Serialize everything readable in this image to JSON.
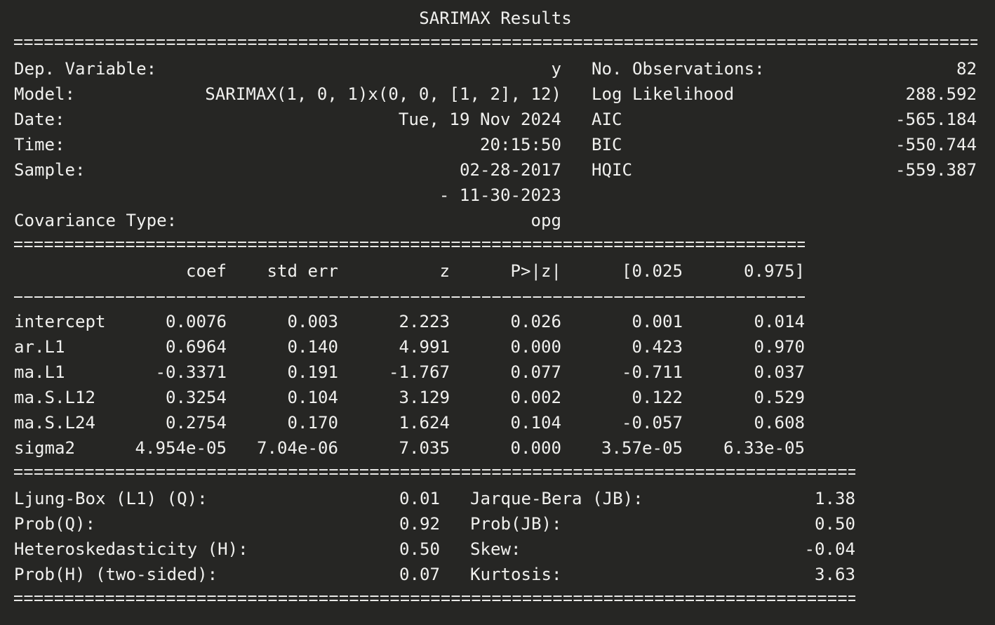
{
  "title": "SARIMAX Results",
  "summary": {
    "left": [
      {
        "label": "Dep. Variable:",
        "value": "y"
      },
      {
        "label": "Model:",
        "value": "SARIMAX(1, 0, 1)x(0, 0, [1, 2], 12)"
      },
      {
        "label": "Date:",
        "value": "Tue, 19 Nov 2024"
      },
      {
        "label": "Time:",
        "value": "20:15:50"
      },
      {
        "label": "Sample:",
        "value": "02-28-2017"
      },
      {
        "label": "",
        "value": "- 11-30-2023"
      },
      {
        "label": "Covariance Type:",
        "value": "opg"
      }
    ],
    "right": [
      {
        "label": "No. Observations:",
        "value": "82"
      },
      {
        "label": "Log Likelihood",
        "value": "288.592"
      },
      {
        "label": "AIC",
        "value": "-565.184"
      },
      {
        "label": "BIC",
        "value": "-550.744"
      },
      {
        "label": "HQIC",
        "value": "-559.387"
      }
    ]
  },
  "coef_table": {
    "headers": [
      "",
      "coef",
      "std err",
      "z",
      "P>|z|",
      "[0.025",
      "0.975]"
    ],
    "rows": [
      [
        "intercept",
        "0.0076",
        "0.003",
        "2.223",
        "0.026",
        "0.001",
        "0.014"
      ],
      [
        "ar.L1",
        "0.6964",
        "0.140",
        "4.991",
        "0.000",
        "0.423",
        "0.970"
      ],
      [
        "ma.L1",
        "-0.3371",
        "0.191",
        "-1.767",
        "0.077",
        "-0.711",
        "0.037"
      ],
      [
        "ma.S.L12",
        "0.3254",
        "0.104",
        "3.129",
        "0.002",
        "0.122",
        "0.529"
      ],
      [
        "ma.S.L24",
        "0.2754",
        "0.170",
        "1.624",
        "0.104",
        "-0.057",
        "0.608"
      ],
      [
        "sigma2",
        "4.954e-05",
        "7.04e-06",
        "7.035",
        "0.000",
        "3.57e-05",
        "6.33e-05"
      ]
    ]
  },
  "diagnostics": {
    "left": [
      {
        "label": "Ljung-Box (L1) (Q):",
        "value": "0.01"
      },
      {
        "label": "Prob(Q):",
        "value": "0.92"
      },
      {
        "label": "Heteroskedasticity (H):",
        "value": "0.50"
      },
      {
        "label": "Prob(H) (two-sided):",
        "value": "0.07"
      }
    ],
    "right": [
      {
        "label": "Jarque-Bera (JB):",
        "value": "1.38"
      },
      {
        "label": "Prob(JB):",
        "value": "0.50"
      },
      {
        "label": "Skew:",
        "value": "-0.04"
      },
      {
        "label": "Kurtosis:",
        "value": "3.63"
      }
    ]
  }
}
